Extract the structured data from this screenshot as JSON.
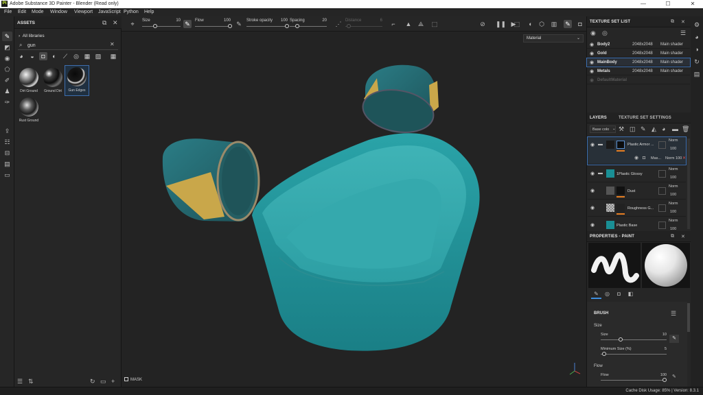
{
  "window": {
    "title": "Adobe Substance 3D Painter - Blender (Read only)",
    "logo": "Pt",
    "minimize": "—",
    "maximize": "☐",
    "close": "✕"
  },
  "menu": [
    "File",
    "Edit",
    "Mode",
    "Window",
    "Viewport",
    "JavaScript",
    "Python",
    "Help"
  ],
  "assets": {
    "title": "ASSETS",
    "breadcrumb": "All libraries",
    "search_value": "gun",
    "items": [
      {
        "label": "Dirt Ground"
      },
      {
        "label": "Ground Dirt"
      },
      {
        "label": "Gun Edges"
      },
      {
        "label": "Rust Ground"
      }
    ]
  },
  "toolbar": {
    "size_label": "Size",
    "size_value": "10",
    "flow_label": "Flow",
    "flow_value": "100",
    "stroke_label": "Stroke opacity",
    "stroke_value": "100",
    "spacing_label": "Spacing",
    "spacing_value": "20",
    "distance_label": "Distance",
    "distance_value": "6"
  },
  "viewport": {
    "material_mode": "Material",
    "mask_label": "MASK"
  },
  "texture_set_list": {
    "title": "TEXTURE SET LIST",
    "rows": [
      {
        "name": "Body2",
        "res": "2048x2048",
        "shader": "Main shader"
      },
      {
        "name": "Gold",
        "res": "2048x2048",
        "shader": "Main shader"
      },
      {
        "name": "MainBody",
        "res": "2048x2048",
        "shader": "Main shader"
      },
      {
        "name": "Metals",
        "res": "2048x2048",
        "shader": "Main shader"
      },
      {
        "name": "DefaultMaterial",
        "res": "",
        "shader": ""
      }
    ]
  },
  "layers": {
    "title": "LAYERS",
    "tab2": "TEXTURE SET SETTINGS",
    "channel": "Base colo",
    "items": [
      {
        "name": "Plastic Armor ...",
        "blend": "Norm",
        "opacity": "100"
      },
      {
        "name": "Mas...",
        "blend": "Norm",
        "opacity": "100"
      },
      {
        "name": "1Plastic Glossy",
        "blend": "Norm",
        "opacity": "100"
      },
      {
        "name": "Dust",
        "blend": "Norm",
        "opacity": "100"
      },
      {
        "name": "Roughness G...",
        "blend": "Norm",
        "opacity": "100"
      },
      {
        "name": "Plastic Base",
        "blend": "Norm",
        "opacity": "100"
      }
    ]
  },
  "properties": {
    "title": "PROPERTIES - PAINT",
    "section": "BRUSH",
    "size_group": "Size",
    "size_label": "Size",
    "size_value": "10",
    "minsize_label": "Minimum Size (%)",
    "minsize_value": "5",
    "flow_group": "Flow",
    "flow_label": "Flow",
    "flow_value": "100"
  },
  "status": {
    "text": "Cache Disk Usage:   85%  |  Version: 8.3.1"
  },
  "colors": {
    "accent": "#3d6fb0",
    "teal": "#1a8f95",
    "orange": "#e67e22"
  }
}
